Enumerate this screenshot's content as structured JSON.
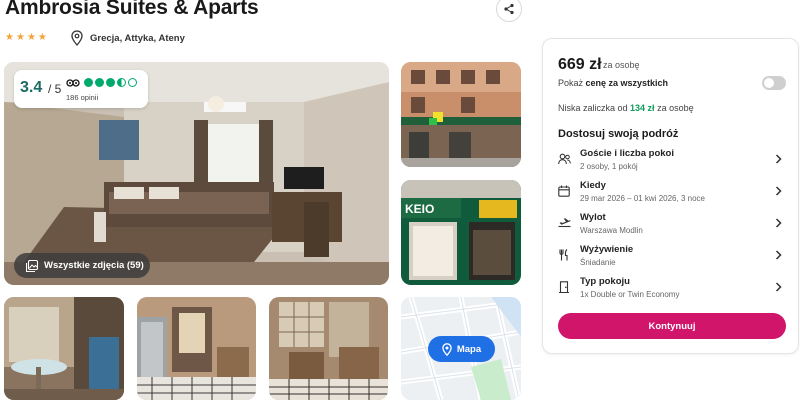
{
  "hotel": {
    "name": "Ambrosia Suites & Aparts",
    "stars": 4,
    "location": "Grecja, Attyka, Ateny"
  },
  "rating": {
    "score": "3.4",
    "max": "/ 5",
    "reviews": "186 opinii",
    "bubbles": 3.5
  },
  "gallery": {
    "all_photos_label": "Wszystkie zdjęcia (59)",
    "map_label": "Mapa"
  },
  "booking": {
    "price": "669 zł",
    "per_person": "za osobę",
    "toggle_prefix": "Pokaż ",
    "toggle_bold": "cenę za wszystkich",
    "toggle_on": false,
    "deposit_prefix": "Niska zaliczka od ",
    "deposit_amount": "134 zł",
    "deposit_suffix": " za osobę",
    "customize_title": "Dostosuj swoją podróż",
    "rows": [
      {
        "icon": "guests-icon",
        "title": "Goście i liczba pokoi",
        "sub": "2 osoby, 1 pokój"
      },
      {
        "icon": "calendar-icon",
        "title": "Kiedy",
        "sub": "29 mar 2026 – 01 kwi 2026, 3 noce"
      },
      {
        "icon": "plane-icon",
        "title": "Wylot",
        "sub": "Warszawa Modlin"
      },
      {
        "icon": "meal-icon",
        "title": "Wyżywienie",
        "sub": "Śniadanie"
      },
      {
        "icon": "door-icon",
        "title": "Typ pokoju",
        "sub": "1x Double or Twin Economy"
      }
    ],
    "continue_label": "Kontynuuj"
  },
  "colors": {
    "accent": "#d1156b",
    "rating_green": "#00aa6c",
    "deposit_green": "#119c5a",
    "map_blue": "#1f6fe5",
    "star": "#f2a33a"
  }
}
